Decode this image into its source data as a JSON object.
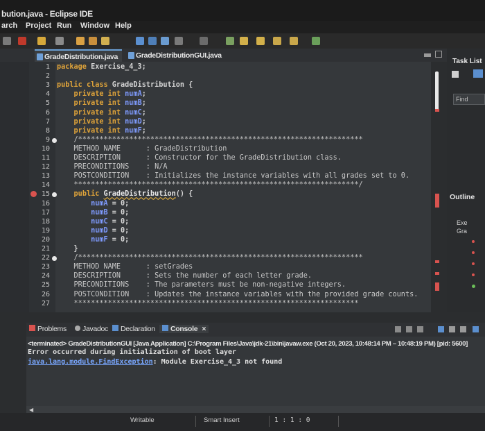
{
  "window": {
    "title": "bution.java - Eclipse IDE"
  },
  "menu": [
    "arch",
    "Project",
    "Run",
    "Window",
    "Help"
  ],
  "editor_tabs": [
    {
      "label": "GradeDistribution.java",
      "close": "×",
      "active": true
    },
    {
      "label": "GradeDistributionGUI.java",
      "active": false
    }
  ],
  "right_panel": {
    "task_list_title": "Task List",
    "find_placeholder": "Find",
    "outline_title": "Outline",
    "outline_items": [
      "Exe",
      "Gra"
    ]
  },
  "code_lines": [
    {
      "n": "1",
      "t": "package Exercise_4_3;"
    },
    {
      "n": "2",
      "t": ""
    },
    {
      "n": "3",
      "t": "public class GradeDistribution {"
    },
    {
      "n": "4",
      "t": "    private int numA;"
    },
    {
      "n": "5",
      "t": "    private int numB;"
    },
    {
      "n": "6",
      "t": "    private int numC;"
    },
    {
      "n": "7",
      "t": "    private int numD;"
    },
    {
      "n": "8",
      "t": "    private int numF;"
    },
    {
      "n": "9",
      "t": "    /*******************************************************************"
    },
    {
      "n": "10",
      "t": "    METHOD NAME      : GradeDistribution"
    },
    {
      "n": "11",
      "t": "    DESCRIPTION      : Constructor for the GradeDistribution class."
    },
    {
      "n": "12",
      "t": "    PRECONDITIONS    : N/A"
    },
    {
      "n": "13",
      "t": "    POSTCONDITION    : Initializes the instance variables with all grades set to 0."
    },
    {
      "n": "14",
      "t": "    *******************************************************************/"
    },
    {
      "n": "15",
      "t": "    public GradeDistribution() {"
    },
    {
      "n": "16",
      "t": "        numA = 0;"
    },
    {
      "n": "17",
      "t": "        numB = 0;"
    },
    {
      "n": "18",
      "t": "        numC = 0;"
    },
    {
      "n": "19",
      "t": "        numD = 0;"
    },
    {
      "n": "20",
      "t": "        numF = 0;"
    },
    {
      "n": "21",
      "t": "    }"
    },
    {
      "n": "22",
      "t": "    /*******************************************************************"
    },
    {
      "n": "23",
      "t": "    METHOD NAME      : setGrades"
    },
    {
      "n": "24",
      "t": "    DESCRIPTION      : Sets the number of each letter grade."
    },
    {
      "n": "25",
      "t": "    PRECONDITIONS    : The parameters must be non-negative integers."
    },
    {
      "n": "26",
      "t": "    POSTCONDITION    : Updates the instance variables with the provided grade counts."
    },
    {
      "n": "27",
      "t": "    *******************************************************************"
    }
  ],
  "console_tabs": [
    {
      "label": "Problems"
    },
    {
      "label": "Javadoc"
    },
    {
      "label": "Declaration"
    },
    {
      "label": "Console",
      "close": "×",
      "active": true
    }
  ],
  "console": {
    "terminated": "<terminated> GradeDistributionGUI [Java Application] C:\\Program Files\\Java\\jdk-21\\bin\\javaw.exe (Oct 20, 2023, 10:48:14 PM – 10:48:19 PM) [pid: 5600]",
    "error_line_1": "Error occurred during initialization of boot layer",
    "error_exception": "java.lang.module.FindException",
    "error_rest": ": Module Exercise_4_3 not found"
  },
  "status": {
    "writable": "Writable",
    "insert": "Smart Insert",
    "position": "1 : 1 : 0"
  },
  "colors": {
    "keyword": "#e0a43a",
    "field": "#7f9bff",
    "link": "#79a7ff",
    "tab_accent": "#6b9fd4",
    "error_marker": "#d9534f"
  }
}
